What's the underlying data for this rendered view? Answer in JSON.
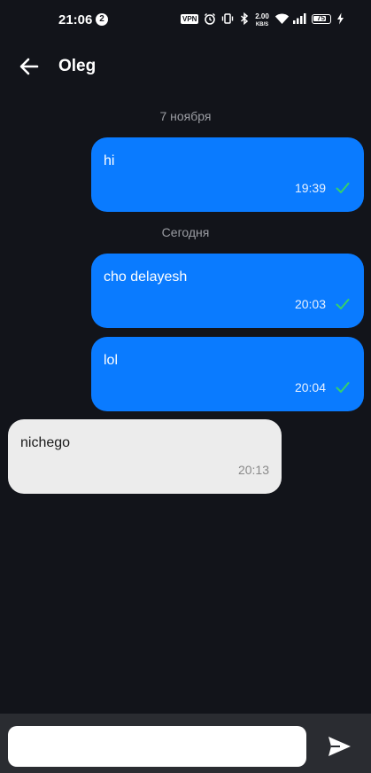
{
  "status_bar": {
    "time": "21:06",
    "notification_count": "2",
    "vpn_label": "VPN",
    "speed_value": "2.00",
    "speed_unit": "KB/S",
    "battery_level": "75",
    "icons": [
      "alarm-icon",
      "vibrate-icon",
      "bluetooth-icon",
      "wifi-icon",
      "signal-icon",
      "charging-icon"
    ]
  },
  "header": {
    "title": "Oleg",
    "back_icon": "arrow-left-icon"
  },
  "messages": {
    "date_1": "7 ноября",
    "date_2": "Сегодня",
    "items": [
      {
        "direction": "out",
        "text": "hi",
        "time": "19:39",
        "status": "sent"
      },
      {
        "direction": "out",
        "text": "cho delayesh",
        "time": "20:03",
        "status": "sent"
      },
      {
        "direction": "out",
        "text": "lol",
        "time": "20:04",
        "status": "sent"
      },
      {
        "direction": "in",
        "text": "nichego",
        "time": "20:13"
      }
    ]
  },
  "composer": {
    "input_value": "",
    "send_icon": "send-icon"
  },
  "colors": {
    "background": "#12141a",
    "outgoing_bubble": "#0a7bff",
    "incoming_bubble": "#ececec",
    "check": "#35d16a",
    "composer_bar": "#2a2c31"
  }
}
